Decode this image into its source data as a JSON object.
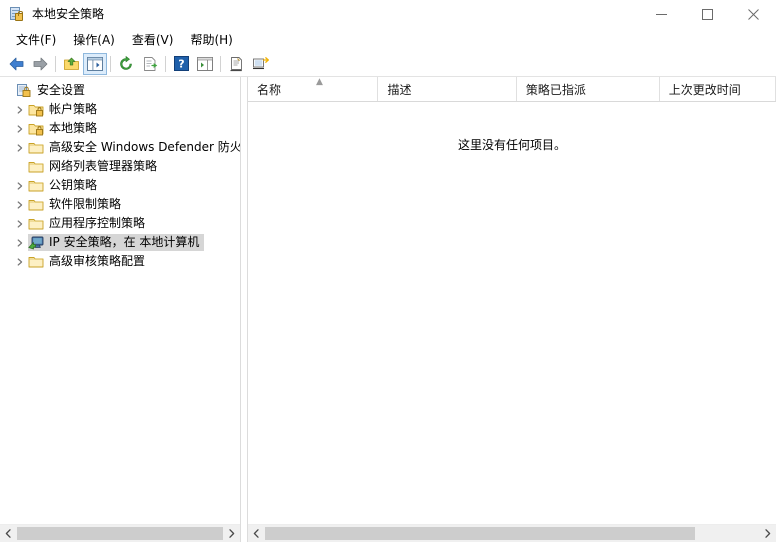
{
  "window": {
    "title": "本地安全策略",
    "icon": "security-policy-icon",
    "controls": {
      "minimize": "最小化",
      "maximize": "最大化",
      "close": "关闭"
    }
  },
  "menubar": {
    "items": [
      {
        "label": "文件(F)",
        "name": "menu-file"
      },
      {
        "label": "操作(A)",
        "name": "menu-action"
      },
      {
        "label": "查看(V)",
        "name": "menu-view"
      },
      {
        "label": "帮助(H)",
        "name": "menu-help"
      }
    ]
  },
  "toolbar": {
    "buttons": [
      {
        "name": "back-icon",
        "tip": "后退"
      },
      {
        "name": "forward-icon",
        "tip": "前进"
      },
      {
        "name": "up-folder-icon",
        "tip": "上移一级"
      },
      {
        "name": "show-hide-tree-icon",
        "tip": "显示/隐藏控制台树",
        "pressed": true
      },
      {
        "name": "refresh-icon",
        "tip": "刷新"
      },
      {
        "name": "export-list-icon",
        "tip": "导出列表"
      },
      {
        "name": "help-icon",
        "tip": "帮助"
      },
      {
        "name": "show-action-pane-icon",
        "tip": "显示/隐藏操作窗格"
      },
      {
        "name": "properties-icon",
        "tip": "属性"
      },
      {
        "name": "create-ip-security-policy-icon",
        "tip": "创建 IP 安全策略"
      }
    ]
  },
  "tree": {
    "items": [
      {
        "label": "安全设置",
        "icon": "security-settings-icon",
        "indent": 0,
        "expandable": false,
        "expanded": true,
        "selected": false,
        "name": "tree-item-security-settings"
      },
      {
        "label": "帐户策略",
        "icon": "folder-lock-icon",
        "indent": 1,
        "expandable": true,
        "expanded": false,
        "selected": false,
        "name": "tree-item-account-policies"
      },
      {
        "label": "本地策略",
        "icon": "folder-lock-icon",
        "indent": 1,
        "expandable": true,
        "expanded": false,
        "selected": false,
        "name": "tree-item-local-policies"
      },
      {
        "label": "高级安全 Windows Defender 防火墙",
        "icon": "folder-icon",
        "indent": 1,
        "expandable": true,
        "expanded": false,
        "selected": false,
        "name": "tree-item-windows-defender-firewall"
      },
      {
        "label": "网络列表管理器策略",
        "icon": "folder-icon",
        "indent": 1,
        "expandable": false,
        "expanded": false,
        "selected": false,
        "name": "tree-item-network-list-manager-policies"
      },
      {
        "label": "公钥策略",
        "icon": "folder-icon",
        "indent": 1,
        "expandable": true,
        "expanded": false,
        "selected": false,
        "name": "tree-item-public-key-policies"
      },
      {
        "label": "软件限制策略",
        "icon": "folder-icon",
        "indent": 1,
        "expandable": true,
        "expanded": false,
        "selected": false,
        "name": "tree-item-software-restriction-policies"
      },
      {
        "label": "应用程序控制策略",
        "icon": "folder-icon",
        "indent": 1,
        "expandable": true,
        "expanded": false,
        "selected": false,
        "name": "tree-item-application-control-policies"
      },
      {
        "label": "IP 安全策略，在 本地计算机",
        "icon": "ip-security-policies-icon",
        "indent": 1,
        "expandable": true,
        "expanded": false,
        "selected": true,
        "name": "tree-item-ip-security-policies"
      },
      {
        "label": "高级审核策略配置",
        "icon": "folder-icon",
        "indent": 1,
        "expandable": true,
        "expanded": false,
        "selected": false,
        "name": "tree-item-advanced-audit-policy-configuration"
      }
    ]
  },
  "list": {
    "columns": [
      {
        "label": "名称",
        "width": 146,
        "sorted": "asc",
        "name": "column-header-name"
      },
      {
        "label": "描述",
        "width": 155,
        "sorted": "",
        "name": "column-header-description"
      },
      {
        "label": "策略已指派",
        "width": 160,
        "sorted": "",
        "name": "column-header-policy-assigned"
      },
      {
        "label": "上次更改时间",
        "width": 130,
        "sorted": "",
        "name": "column-header-last-modified"
      }
    ],
    "rows": [],
    "empty_message": "这里没有任何项目。"
  },
  "scrollbars": {
    "left": {
      "thumb_left_pct": 0,
      "thumb_width_pct": 100
    },
    "right": {
      "thumb_left_pct": 0,
      "thumb_width_pct": 87
    }
  },
  "colors": {
    "selection": "#d6d6d6",
    "folder": "#fde6a0",
    "folder_border": "#c9a227",
    "accent": "#0078d7"
  }
}
